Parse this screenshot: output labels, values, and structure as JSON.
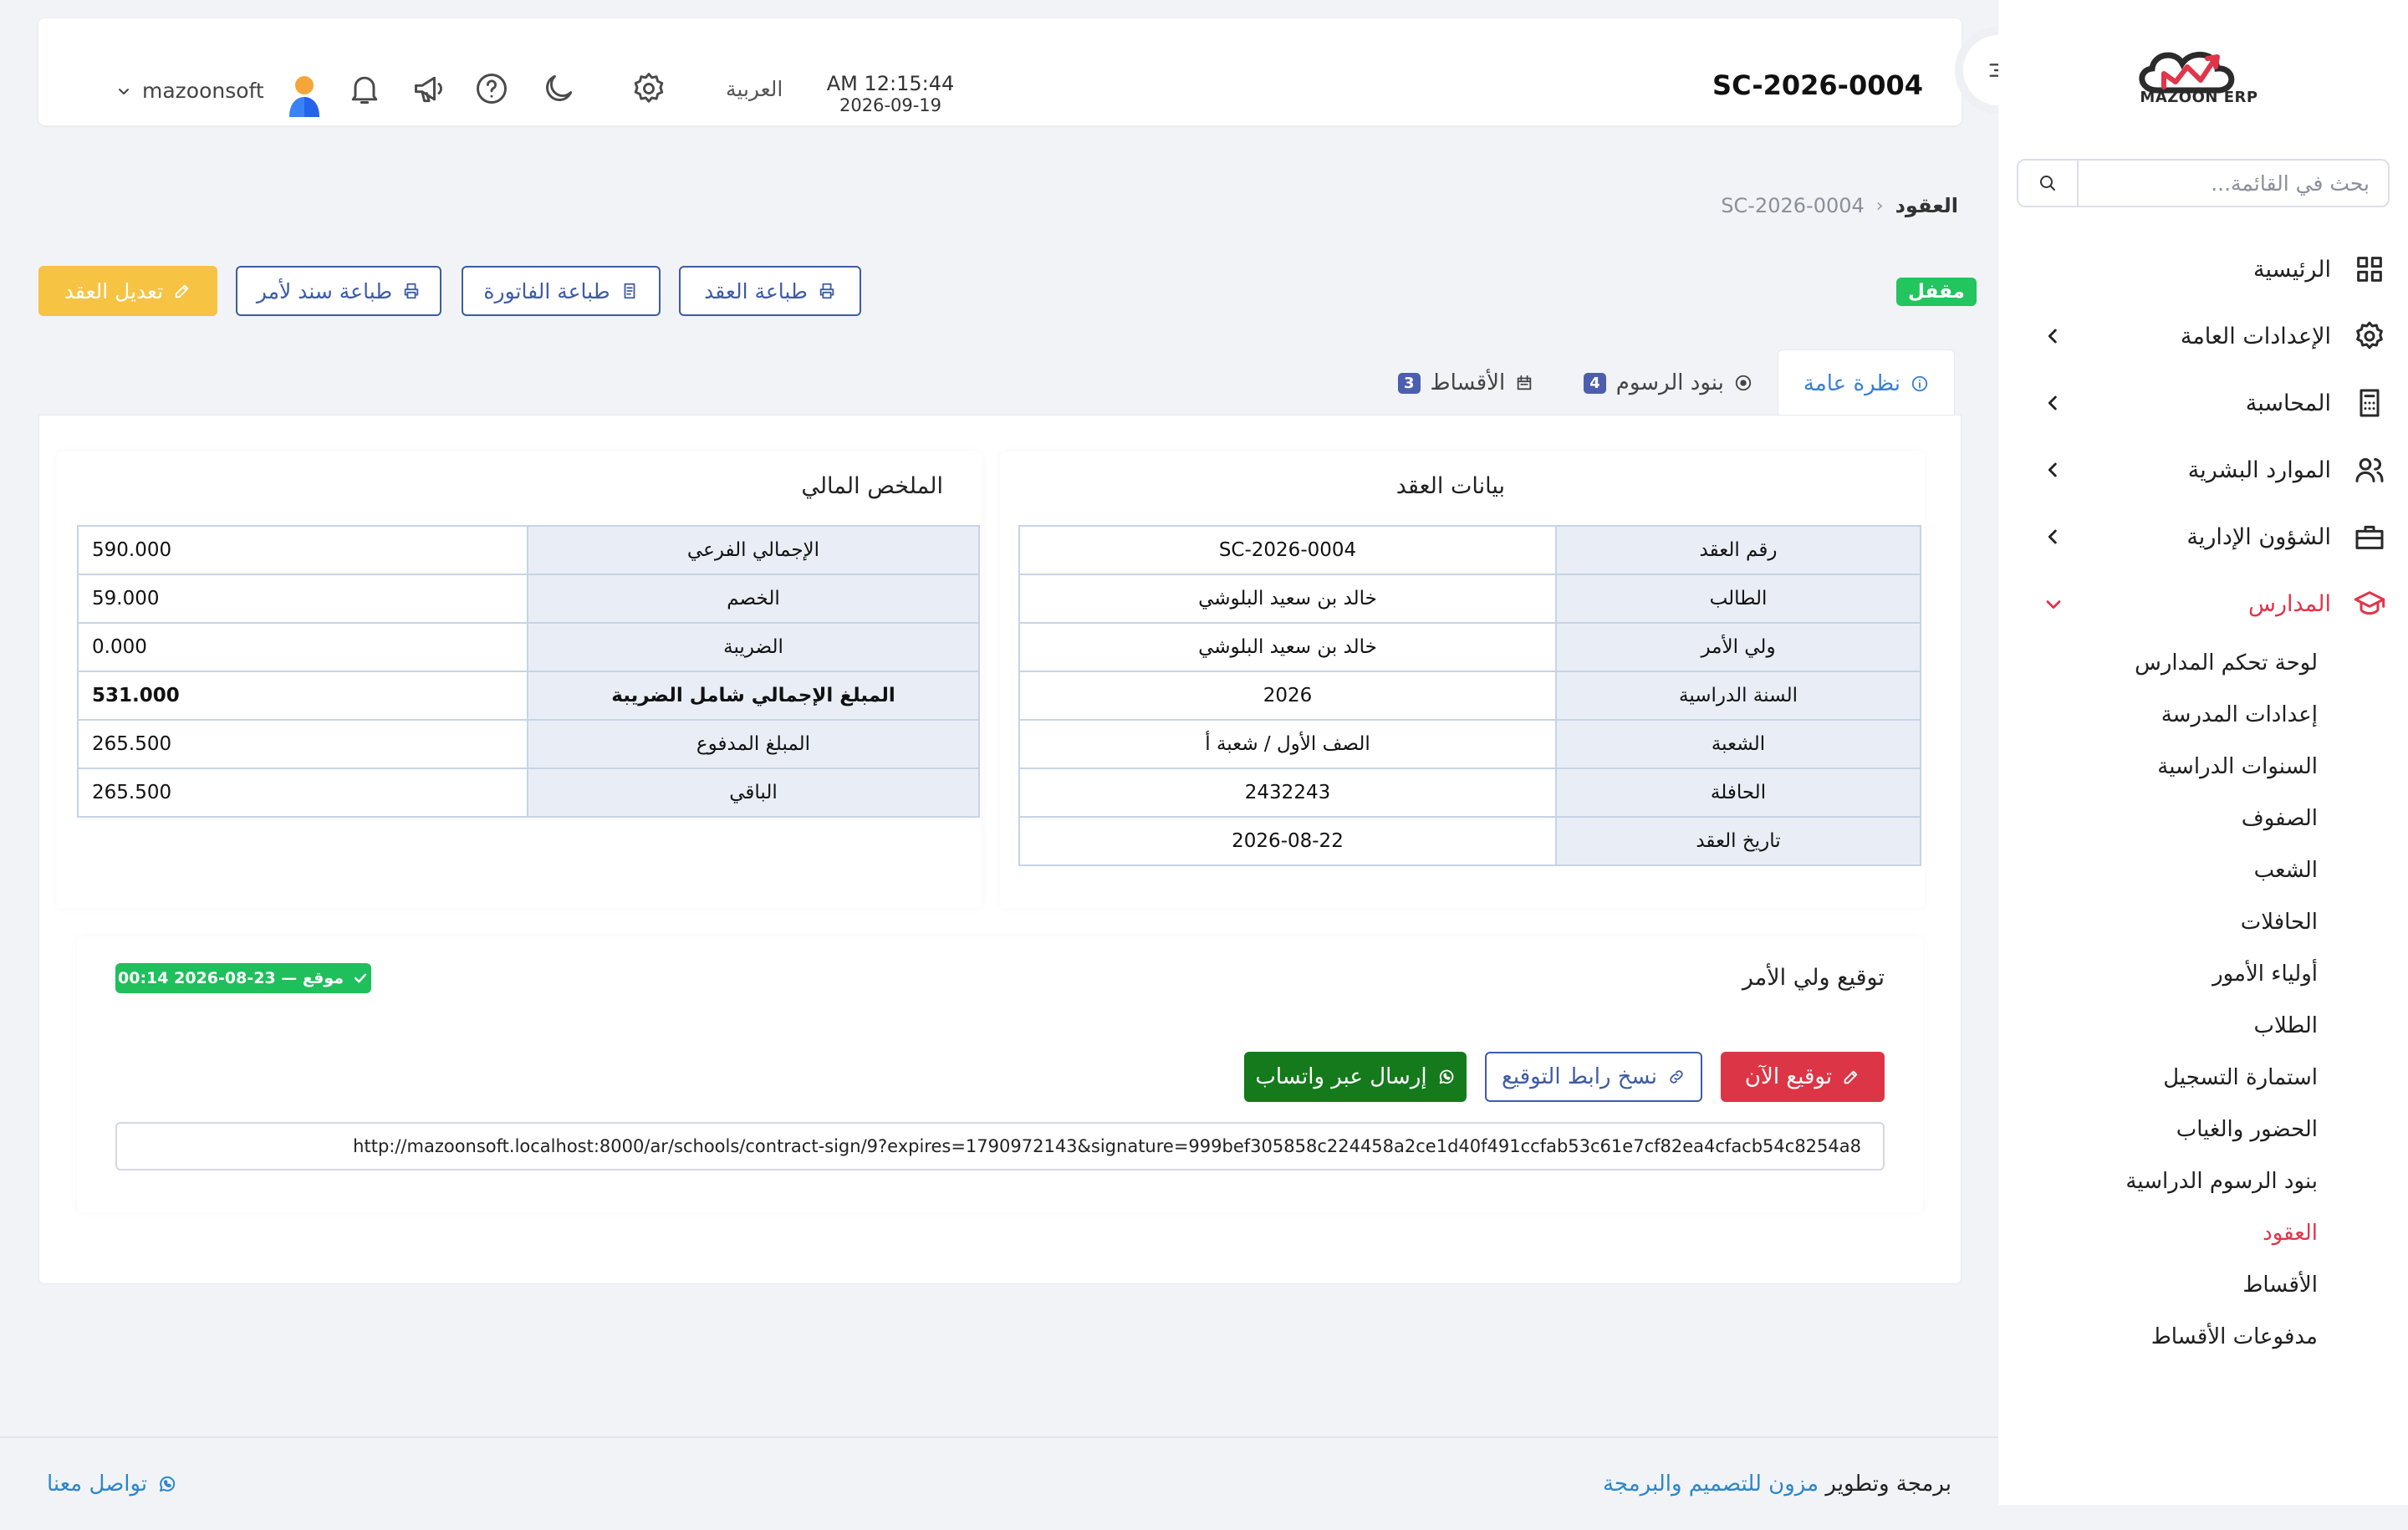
{
  "app": {
    "logo_text": "MAZOON ERP"
  },
  "sidebar": {
    "search_placeholder": "بحث في القائمة...",
    "items": [
      {
        "label": "الرئيسية",
        "icon": "grid-icon"
      },
      {
        "label": "الإعدادات العامة",
        "icon": "gear-icon"
      },
      {
        "label": "المحاسبة",
        "icon": "calculator-icon"
      },
      {
        "label": "الموارد البشرية",
        "icon": "users-icon"
      },
      {
        "label": "الشؤون الإدارية",
        "icon": "briefcase-icon"
      },
      {
        "label": "المدارس",
        "icon": "graduation-cap-icon"
      }
    ],
    "schools_sub": [
      "لوحة تحكم المدارس",
      "إعدادات المدرسة",
      "السنوات الدراسية",
      "الصفوف",
      "الشعب",
      "الحافلات",
      "أولياء الأمور",
      "الطلاب",
      "استمارة التسجيل",
      "الحضور والغياب",
      "بنود الرسوم الدراسية",
      "العقود",
      "الأقساط",
      "مدفوعات الأقساط"
    ],
    "active_sub": "العقود"
  },
  "topbar": {
    "page_code": "SC-2026-0004",
    "time": "AM 12:15:44",
    "date": "2026-09-19",
    "language": "العربية",
    "username": "mazoonsoft"
  },
  "breadcrumb": {
    "parent": "العقود",
    "current": "SC-2026-0004"
  },
  "actions": {
    "status": "مقفل",
    "print_contract": "طباعة العقد",
    "print_invoice": "طباعة الفاتورة",
    "print_promissory": "طباعة سند لأمر",
    "edit_contract": "تعديل العقد"
  },
  "tabs": [
    {
      "label": "نظرة عامة"
    },
    {
      "label": "بنود الرسوم",
      "count": "4"
    },
    {
      "label": "الأقساط",
      "count": "3"
    }
  ],
  "contract": {
    "title": "بيانات العقد",
    "rows": [
      {
        "key": "رقم العقد",
        "value": "SC-2026-0004"
      },
      {
        "key": "الطالب",
        "value": "خالد بن سعيد البلوشي"
      },
      {
        "key": "ولي الأمر",
        "value": "خالد بن سعيد البلوشي"
      },
      {
        "key": "السنة الدراسية",
        "value": "2026"
      },
      {
        "key": "الشعبة",
        "value": "الصف الأول / شعبة أ"
      },
      {
        "key": "الحافلة",
        "value": "2432243"
      },
      {
        "key": "تاريخ العقد",
        "value": "2026-08-22"
      }
    ]
  },
  "finance": {
    "title": "الملخص المالي",
    "rows": [
      {
        "key": "الإجمالي الفرعي",
        "value": "590.000"
      },
      {
        "key": "الخصم",
        "value": "59.000"
      },
      {
        "key": "الضريبة",
        "value": "0.000"
      },
      {
        "key": "المبلغ الإجمالي شامل الضريبة",
        "value": "531.000"
      },
      {
        "key": "المبلغ المدفوع",
        "value": "265.500"
      },
      {
        "key": "الباقي",
        "value": "265.500"
      }
    ]
  },
  "signature": {
    "title": "توقيع ولي الأمر",
    "signed_badge": "موقع — 23-08-2026 00:14",
    "sign_now": "توقيع الآن",
    "copy_link": "نسخ رابط التوقيع",
    "send_whatsapp": "إرسال عبر واتساب",
    "url": "http://mazoonsoft.localhost:8000/ar/schools/contract-sign/9?expires=1790972143&signature=999bef305858c224458a2ce1d40f491ccfab53c61e7cf82ea4cfacb54c8254a8"
  },
  "footer": {
    "prefix": "برمجة وتطوير",
    "brand": "مزون للتصميم والبرمجة",
    "contact": "تواصل معنا"
  },
  "colors": {
    "accent": "#3e5ba5",
    "danger": "#e0354a",
    "success": "#1aa44a",
    "warning": "#f6c343",
    "link": "#2c87c9"
  }
}
